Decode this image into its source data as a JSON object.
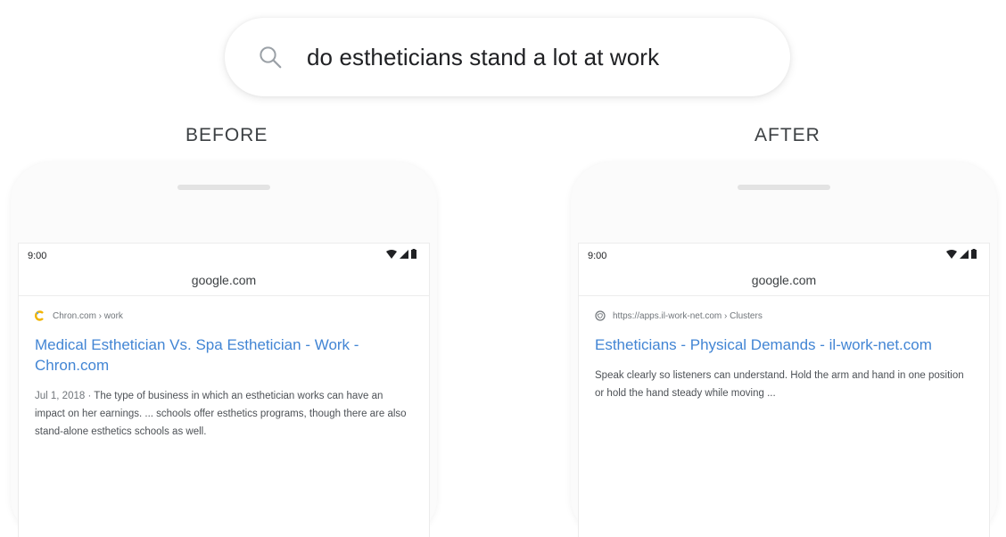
{
  "search": {
    "query": "do estheticians stand a lot at work"
  },
  "before": {
    "label": "BEFORE",
    "time": "9:00",
    "url": "google.com",
    "result": {
      "source": "Chron.com › work",
      "title": "Medical Esthetician Vs. Spa Esthetician - Work - Chron.com",
      "date": "Jul 1, 2018 ·",
      "snippet": "The type of business in which an esthetician works can have an impact on her earnings. ... schools offer esthetics programs, though there are also stand-alone esthetics schools as well."
    }
  },
  "after": {
    "label": "AFTER",
    "time": "9:00",
    "url": "google.com",
    "result": {
      "source": "https://apps.il-work-net.com › Clusters",
      "title": "Estheticians - Physical Demands - il-work-net.com",
      "snippet": "Speak clearly so listeners can understand. Hold the arm and hand in one position or hold the hand steady while moving ..."
    }
  },
  "colors": {
    "result_title": "#4285d4",
    "chron_icon": "#f2b400"
  }
}
